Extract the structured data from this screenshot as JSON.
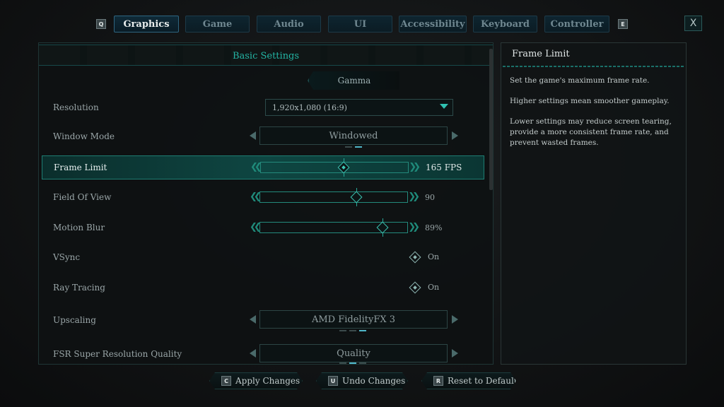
{
  "tabs": {
    "prev_key": "Q",
    "next_key": "E",
    "items": [
      {
        "label": "Graphics",
        "active": true
      },
      {
        "label": "Game"
      },
      {
        "label": "Audio"
      },
      {
        "label": "UI"
      },
      {
        "label": "Accessibility"
      },
      {
        "label": "Keyboard"
      },
      {
        "label": "Controller"
      }
    ],
    "close_label": "X"
  },
  "main": {
    "section_title": "Basic Settings",
    "gamma_label": "Gamma",
    "settings": {
      "resolution": {
        "label": "Resolution",
        "value": "1,920x1,080 (16:9)"
      },
      "window_mode": {
        "label": "Window Mode",
        "value": "Windowed",
        "option_index": 2,
        "option_count": 2
      },
      "frame_limit": {
        "label": "Frame Limit",
        "value": "165 FPS",
        "slider_fraction": 0.56
      },
      "fov": {
        "label": "Field Of View",
        "value": "90",
        "slider_fraction": 0.65
      },
      "motion_blur": {
        "label": "Motion Blur",
        "value": "89%",
        "slider_fraction": 0.83
      },
      "vsync": {
        "label": "VSync",
        "value": "On"
      },
      "ray_tracing": {
        "label": "Ray Tracing",
        "value": "On"
      },
      "upscaling": {
        "label": "Upscaling",
        "value": "AMD FidelityFX 3",
        "option_index": 3,
        "option_count": 3
      },
      "fsr_quality": {
        "label": "FSR Super Resolution Quality",
        "value": "Quality",
        "option_index": 2,
        "option_count": 3
      }
    }
  },
  "info": {
    "title": "Frame Limit",
    "paragraphs": [
      "Set the game's maximum frame rate.",
      "Higher settings mean smoother gameplay.",
      "Lower settings may reduce screen tearing, provide a more consistent frame rate, and prevent wasted frames."
    ]
  },
  "footer": {
    "apply": {
      "key": "C",
      "label": "Apply Changes"
    },
    "undo": {
      "key": "U",
      "label": "Undo Changes"
    },
    "reset": {
      "key": "R",
      "label": "Reset to Default"
    }
  },
  "colors": {
    "accent": "#23b3a3",
    "highlight": "#0e4642"
  }
}
